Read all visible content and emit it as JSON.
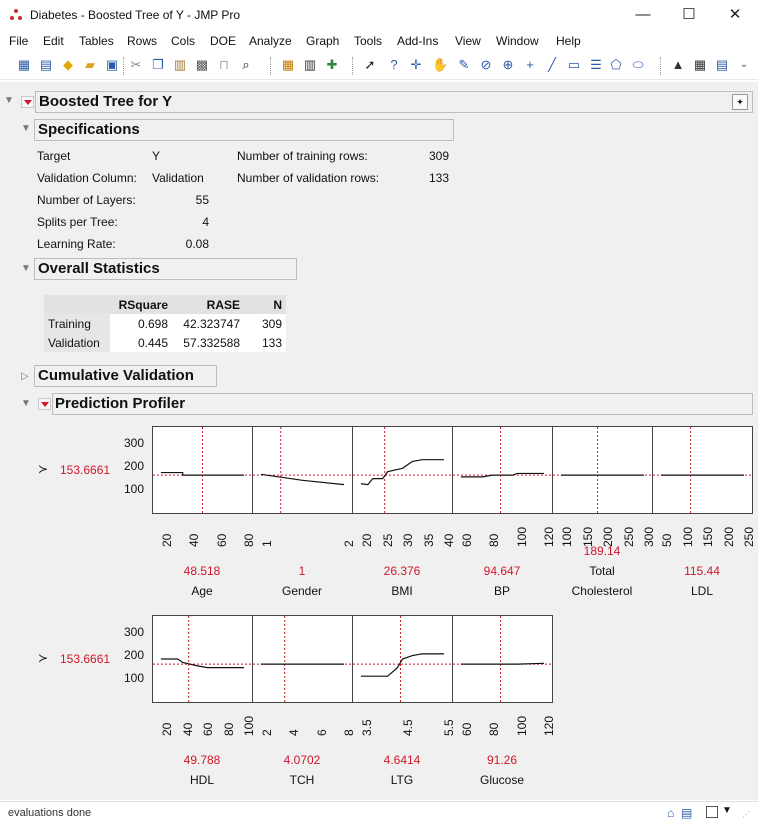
{
  "window": {
    "title": "Diabetes - Boosted Tree of Y - JMP Pro",
    "minimize": "—",
    "maximize": "☐",
    "close": "✕"
  },
  "menu": [
    "File",
    "Edit",
    "Tables",
    "Rows",
    "Cols",
    "DOE",
    "Analyze",
    "Graph",
    "Tools",
    "Add-Ins",
    "View",
    "Window",
    "Help"
  ],
  "report": {
    "title": "Boosted Tree for Y",
    "specifications": {
      "heading": "Specifications",
      "target_label": "Target",
      "target_value": "Y",
      "validation_label": "Validation Column:",
      "validation_value": "Validation",
      "layers_label": "Number of Layers:",
      "layers_value": "55",
      "splits_label": "Splits per Tree:",
      "splits_value": "4",
      "lr_label": "Learning Rate:",
      "lr_value": "0.08",
      "train_rows_label": "Number of training rows:",
      "train_rows_value": "309",
      "val_rows_label": "Number of validation rows:",
      "val_rows_value": "133"
    },
    "overall": {
      "heading": "Overall Statistics",
      "columns": [
        "RSquare",
        "RASE",
        "N"
      ],
      "rows": [
        {
          "label": "Training",
          "rsquare": "0.698",
          "rase": "42.323747",
          "n": "309"
        },
        {
          "label": "Validation",
          "rsquare": "0.445",
          "rase": "57.332588",
          "n": "133"
        }
      ]
    },
    "cumulative": {
      "heading": "Cumulative Validation"
    },
    "profiler": {
      "heading": "Prediction Profiler",
      "y_value": "153.6661",
      "y_symbol": "Y",
      "y_ticks": [
        "300",
        "200",
        "100"
      ],
      "row1": [
        {
          "name": "Age",
          "value": "48.518",
          "ticks": [
            "20",
            "40",
            "60",
            "80"
          ]
        },
        {
          "name": "Gender",
          "value": "1",
          "ticks": [
            "1",
            "2"
          ]
        },
        {
          "name": "BMI",
          "value": "26.376",
          "ticks": [
            "20",
            "25",
            "30",
            "35",
            "40"
          ]
        },
        {
          "name": "BP",
          "value": "94.647",
          "ticks": [
            "60",
            "80",
            "100",
            "120"
          ]
        },
        {
          "name": "Total",
          "name2": "Cholesterol",
          "value": "189.14",
          "ticks": [
            "100",
            "150",
            "200",
            "250",
            "300"
          ]
        },
        {
          "name": "LDL",
          "value": "115.44",
          "ticks": [
            "50",
            "100",
            "150",
            "200",
            "250"
          ]
        }
      ],
      "row2": [
        {
          "name": "HDL",
          "value": "49.788",
          "ticks": [
            "20",
            "40",
            "60",
            "80",
            "100"
          ]
        },
        {
          "name": "TCH",
          "value": "4.0702",
          "ticks": [
            "2",
            "4",
            "6",
            "8"
          ]
        },
        {
          "name": "LTG",
          "value": "4.6414",
          "ticks": [
            "3.5",
            "4.5",
            "5.5"
          ]
        },
        {
          "name": "Glucose",
          "value": "91.26",
          "ticks": [
            "60",
            "80",
            "100",
            "120"
          ]
        }
      ]
    }
  },
  "status": {
    "message": "evaluations done"
  },
  "colors": {
    "accent_red": "#d0182a",
    "panel_bg": "#f0f0f0"
  }
}
